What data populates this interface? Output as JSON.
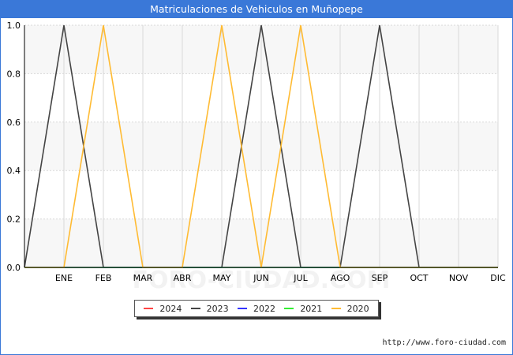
{
  "header": {
    "title": "Matriculaciones de Vehiculos en Muñopepe"
  },
  "watermark": "FORO-CIUDAD.COM",
  "source": "http://www.foro-ciudad.com",
  "chart_data": {
    "type": "line",
    "title": "Matriculaciones de Vehiculos en Muñopepe",
    "xlabel": "",
    "ylabel": "",
    "categories": [
      "",
      "ENE",
      "FEB",
      "MAR",
      "ABR",
      "MAY",
      "JUN",
      "JUL",
      "AGO",
      "SEP",
      "OCT",
      "NOV",
      "DIC"
    ],
    "yticks": [
      "0.0",
      "0.2",
      "0.4",
      "0.6",
      "0.8",
      "1.0"
    ],
    "ylim": [
      0,
      1
    ],
    "grid": true,
    "legend_position": "bottom",
    "series": [
      {
        "name": "2024",
        "color": "#ff4444",
        "values": [
          0,
          0,
          0,
          0,
          0,
          0,
          0,
          0,
          0,
          0,
          0,
          0,
          0
        ]
      },
      {
        "name": "2023",
        "color": "#444444",
        "values": [
          0,
          1,
          0,
          0,
          0,
          0,
          1,
          0,
          0,
          1,
          0,
          0,
          0
        ]
      },
      {
        "name": "2022",
        "color": "#3333ff",
        "values": [
          0,
          0,
          0,
          0,
          0,
          0,
          0,
          0,
          0,
          0,
          0,
          0,
          0
        ]
      },
      {
        "name": "2021",
        "color": "#33ee33",
        "values": [
          0,
          0,
          0,
          0,
          0,
          0,
          0,
          0,
          0,
          0,
          0,
          0,
          0
        ]
      },
      {
        "name": "2020",
        "color": "#ffbb33",
        "values": [
          0,
          0,
          1,
          0,
          0,
          1,
          0,
          1,
          0,
          0,
          0,
          0,
          0
        ]
      }
    ]
  }
}
